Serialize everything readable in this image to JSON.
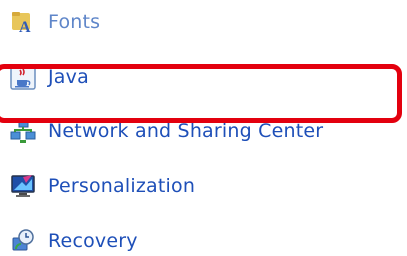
{
  "control_panel": {
    "items": [
      {
        "label": "Fonts",
        "icon": "fonts-folder-icon"
      },
      {
        "label": "Java",
        "icon": "java-cup-icon"
      },
      {
        "label": "Network and Sharing Center",
        "icon": "network-icon"
      },
      {
        "label": "Personalization",
        "icon": "monitor-personalization-icon"
      },
      {
        "label": "Recovery",
        "icon": "recovery-icon"
      }
    ],
    "highlighted_item": "Java"
  },
  "colors": {
    "link_text": "#1e4fb8",
    "faded_link_text": "#5f86c9",
    "highlight_border": "#e3000e",
    "background": "#ffffff"
  }
}
